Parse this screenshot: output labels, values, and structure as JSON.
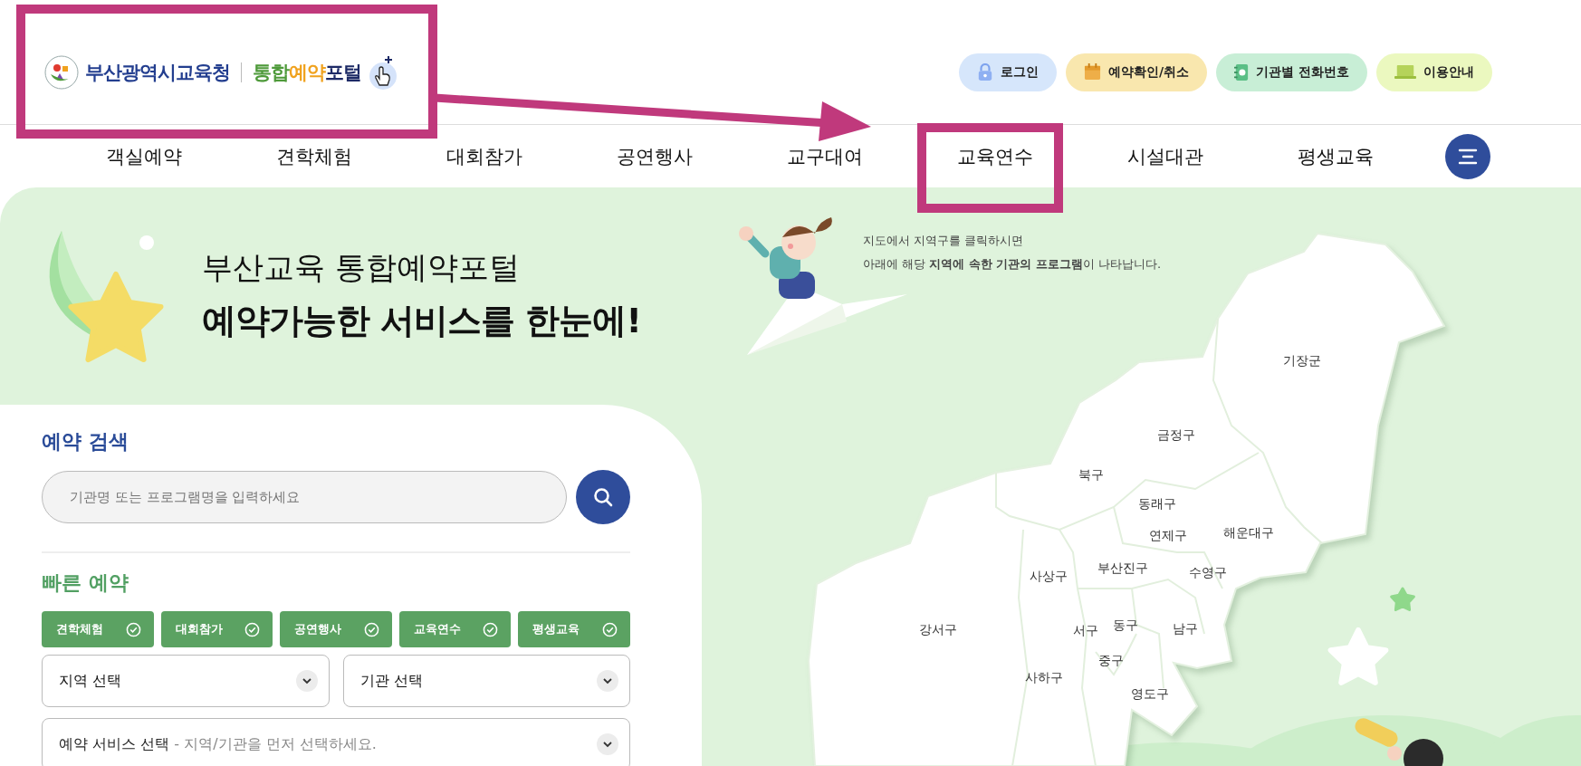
{
  "logo": {
    "org_name": "부산광역시교육청",
    "portal_name": [
      {
        "text": "통합",
        "color": "#4e9a3a"
      },
      {
        "text": "예약",
        "color": "#f0a21e"
      },
      {
        "text": "포털",
        "color": "#1d2a66"
      }
    ]
  },
  "utility_buttons": [
    {
      "label": "로그인",
      "kind": "lock",
      "color": "#d6e6fb"
    },
    {
      "label": "예약확인/취소",
      "kind": "calendar",
      "color": "#f9e7ae"
    },
    {
      "label": "기관별 전화번호",
      "kind": "phonebook",
      "color": "#c8eed6"
    },
    {
      "label": "이용안내",
      "kind": "laptop",
      "color": "#ebf8bf"
    }
  ],
  "nav": {
    "items": [
      "객실예약",
      "견학체험",
      "대회참가",
      "공연행사",
      "교구대여",
      "교육연수",
      "시설대관",
      "평생교육"
    ]
  },
  "hero": {
    "subtitle": "부산교육 통합예약포털",
    "title": "예약가능한 서비스를 한눈에!"
  },
  "search": {
    "heading": "예약 검색",
    "placeholder": "기관명 또는 프로그램명을 입력하세요"
  },
  "quick": {
    "heading": "빠른 예약",
    "chips": [
      "견학체험",
      "대회참가",
      "공연행사",
      "교육연수",
      "평생교육"
    ],
    "selects": [
      {
        "label": "지역 선택"
      },
      {
        "label": "기관 선택"
      }
    ],
    "service_select": {
      "label": "예약 서비스 선택",
      "hint": "- 지역/기관을 먼저 선택하세요."
    }
  },
  "map": {
    "guide": [
      "지도에서 지역구를 클릭하시면",
      "아래에 해당 **지역에 속한 기관의 프로그램**이 나타납니다."
    ],
    "districts": [
      "기장군",
      "금정구",
      "북구",
      "동래구",
      "연제구",
      "해운대구",
      "사상구",
      "부산진구",
      "수영구",
      "강서구",
      "서구",
      "동구",
      "남구",
      "중구",
      "사하구",
      "영도구"
    ]
  }
}
